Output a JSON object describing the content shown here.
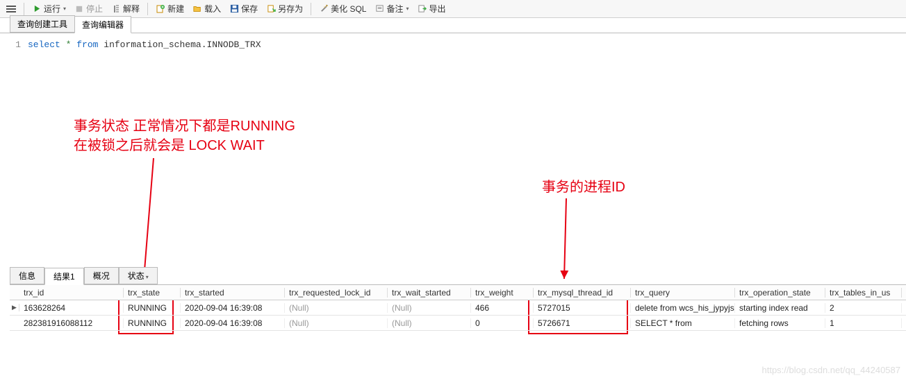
{
  "toolbar": {
    "run": "运行",
    "stop": "停止",
    "explain": "解释",
    "new": "新建",
    "load": "载入",
    "save": "保存",
    "saveAs": "另存为",
    "beautify": "美化 SQL",
    "comment": "备注",
    "export": "导出"
  },
  "editorTabs": {
    "builder": "查询创建工具",
    "editor": "查询编辑器"
  },
  "editor": {
    "lineNo": "1",
    "kw_select": "select",
    "kw_star": "*",
    "kw_from": "from",
    "table": " information_schema.INNODB_TRX"
  },
  "annotations": {
    "state_line1": "事务状态 正常情况下都是RUNNING",
    "state_line2": "在被锁之后就会是 LOCK WAIT",
    "thread": "事务的进程ID"
  },
  "resultTabs": {
    "info": "信息",
    "result1": "结果1",
    "profile": "概况",
    "status": "状态"
  },
  "columns": {
    "trx_id": "trx_id",
    "trx_state": "trx_state",
    "trx_started": "trx_started",
    "trx_requested_lock_id": "trx_requested_lock_id",
    "trx_wait_started": "trx_wait_started",
    "trx_weight": "trx_weight",
    "trx_mysql_thread_id": "trx_mysql_thread_id",
    "trx_query": "trx_query",
    "trx_operation_state": "trx_operation_state",
    "trx_tables_in_use": "trx_tables_in_us"
  },
  "rows": [
    {
      "trx_id": "163628264",
      "trx_state": "RUNNING",
      "trx_started": "2020-09-04 16:39:08",
      "trx_requested_lock_id": "(Null)",
      "trx_wait_started": "(Null)",
      "trx_weight": "466",
      "trx_mysql_thread_id": "5727015",
      "trx_query": "delete from wcs_his_jypyjs",
      "trx_operation_state": "starting index read",
      "trx_tables_in_use": "2"
    },
    {
      "trx_id": "282381916088112",
      "trx_state": "RUNNING",
      "trx_started": "2020-09-04 16:39:08",
      "trx_requested_lock_id": "(Null)",
      "trx_wait_started": "(Null)",
      "trx_weight": "0",
      "trx_mysql_thread_id": "5726671",
      "trx_query": "SELECT      *       from",
      "trx_operation_state": "fetching rows",
      "trx_tables_in_use": "1"
    }
  ],
  "watermark": "https://blog.csdn.net/qq_44240587"
}
